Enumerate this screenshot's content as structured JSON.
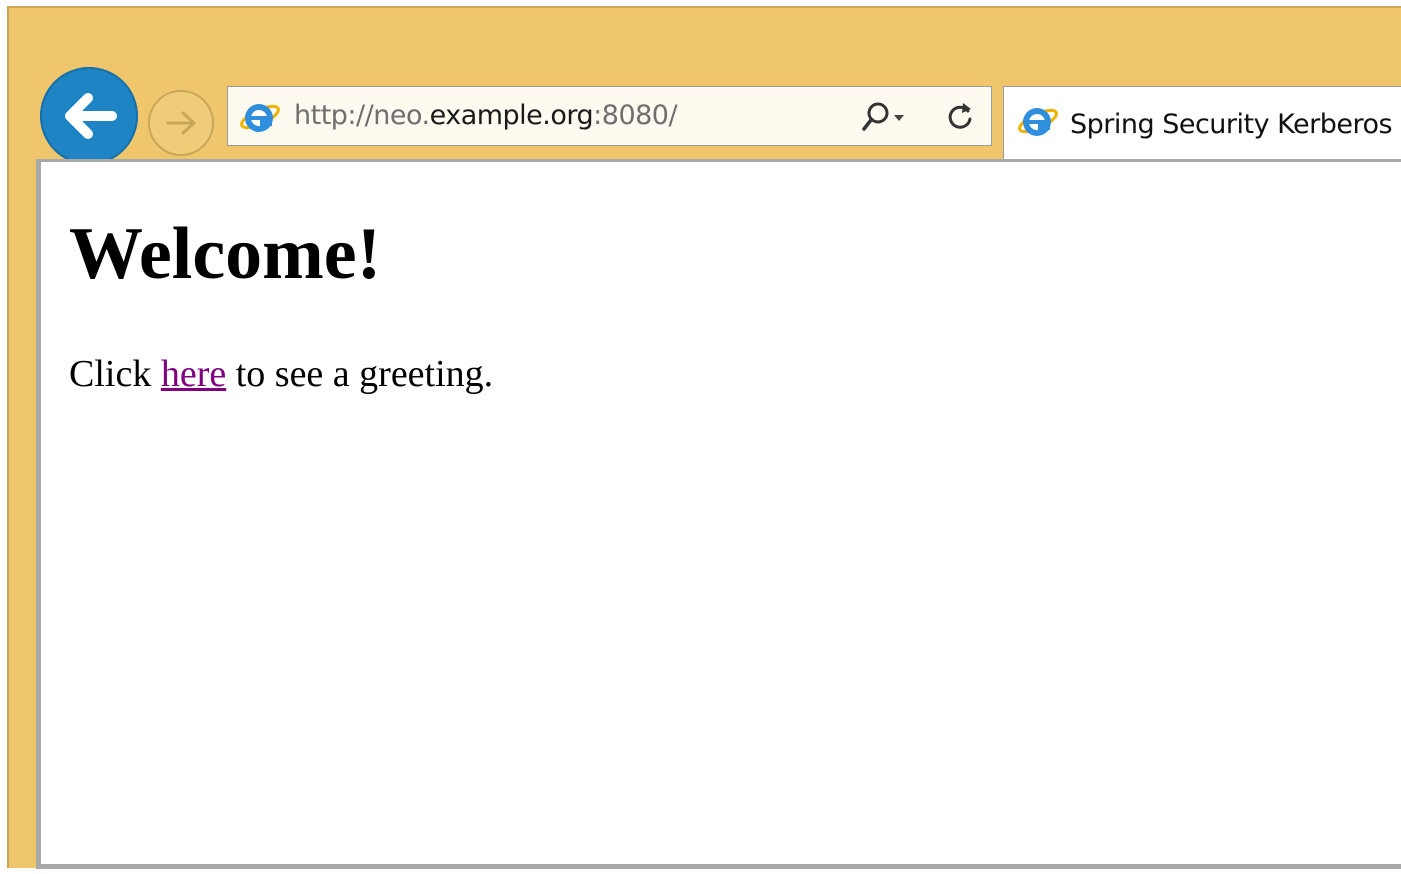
{
  "browser": {
    "address_bar": {
      "url_scheme": "http://neo.",
      "url_host": "example.org",
      "url_rest": ":8080/"
    },
    "tab": {
      "title": "Spring Security Kerberos"
    },
    "icons": {
      "back": "arrow-left-icon",
      "forward": "arrow-right-icon",
      "site": "internet-explorer-icon",
      "search": "search-icon",
      "dropdown": "chevron-down-icon",
      "refresh": "refresh-icon"
    },
    "colors": {
      "frame": "#efc66b",
      "back_button": "#1e84c4",
      "link_visited": "#800080"
    }
  },
  "page": {
    "heading": "Welcome!",
    "text_before": "Click ",
    "link_text": "here",
    "text_after": " to see a greeting."
  }
}
